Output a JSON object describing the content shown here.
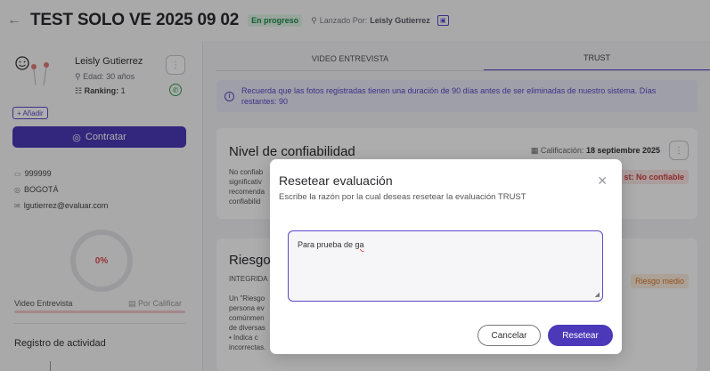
{
  "header": {
    "back_icon": "arrow-left-icon",
    "title": "TEST SOLO VE 2025 09 02",
    "status": "En progreso",
    "launched_label": "Lanzado Por:",
    "launched_by": "Leisly Gutierrez"
  },
  "profile": {
    "name": "Leisly Gutierrez",
    "age": "Edad: 30 años",
    "ranking_label": "Ranking:",
    "ranking_value": "1",
    "add_label": "+ Añadir",
    "hire_label": "Contratar",
    "document": "999999",
    "city": "BOGOTÁ",
    "email": "lgutierrez@evaluar.com",
    "progress_percent": "0%",
    "video_label": "Video Entrevista",
    "video_status": "Por Calificar",
    "activity_title": "Registro de actividad"
  },
  "tabs": [
    "VIDEO ENTREVISTA",
    "TRUST"
  ],
  "notice": {
    "line1": "Recuerda que las fotos registradas tienen una duración de 90 días antes de ser eliminadas de nuestro sistema. Días",
    "line2": "restantes: 90"
  },
  "card1": {
    "title": "Nivel de confiabilidad",
    "rating_label": "Calificación:",
    "rating_date": "18 septiembre 2025",
    "lines": [
      "No confiab",
      "significativ",
      "recomenda",
      "confiabilid"
    ],
    "badge": "st: No confiable"
  },
  "card2": {
    "title": "Riesgos",
    "subtitle": "INTEGRIDA",
    "lines": [
      "Un \"Riesgo",
      "persona ev",
      "comúnmen",
      "de diversas",
      "•  Indica c",
      "   incorrectas."
    ],
    "badge": "Riesgo medio"
  },
  "modal": {
    "title": "Resetear evaluación",
    "description": "Escribe la razón por la cual deseas resetear la evaluación TRUST",
    "textarea_text": "Para prueba de ",
    "textarea_misspelled": "ga",
    "cancel_label": "Cancelar",
    "reset_label": "Resetear"
  }
}
